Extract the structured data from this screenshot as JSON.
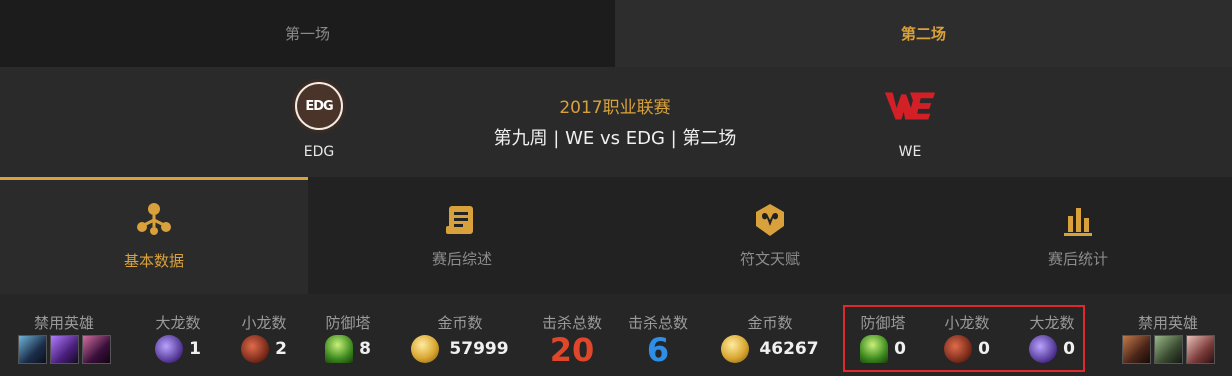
{
  "game_tabs": [
    {
      "label": "第一场",
      "active": false
    },
    {
      "label": "第二场",
      "active": true
    }
  ],
  "match": {
    "team_left": {
      "name": "EDG",
      "logo_text": "EDG"
    },
    "team_right": {
      "name": "WE",
      "logo_text": "WE"
    },
    "league": "2017职业联赛",
    "round": "第九周 | WE vs EDG | 第二场"
  },
  "section_tabs": [
    {
      "label": "基本数据",
      "icon": "network-icon",
      "active": true
    },
    {
      "label": "赛后综述",
      "icon": "document-icon",
      "active": false
    },
    {
      "label": "符文天赋",
      "icon": "ram-shield-icon",
      "active": false
    },
    {
      "label": "赛后统计",
      "icon": "bar-chart-icon",
      "active": false
    }
  ],
  "stats": {
    "left": {
      "bans_label": "禁用英雄",
      "baron_label": "大龙数",
      "baron": "1",
      "dragon_label": "小龙数",
      "dragon": "2",
      "tower_label": "防御塔",
      "tower": "8",
      "gold_label": "金币数",
      "gold": "57999",
      "kills_label": "击杀总数",
      "kills": "20"
    },
    "right": {
      "kills_label": "击杀总数",
      "kills": "6",
      "gold_label": "金币数",
      "gold": "46267",
      "tower_label": "防御塔",
      "tower": "0",
      "dragon_label": "小龙数",
      "dragon": "0",
      "baron_label": "大龙数",
      "baron": "0",
      "bans_label": "禁用英雄"
    }
  },
  "colors": {
    "accent": "#d9a13b",
    "kills_left": "#e0462a",
    "kills_right": "#2f8ee6",
    "highlight": "#e0282e"
  }
}
